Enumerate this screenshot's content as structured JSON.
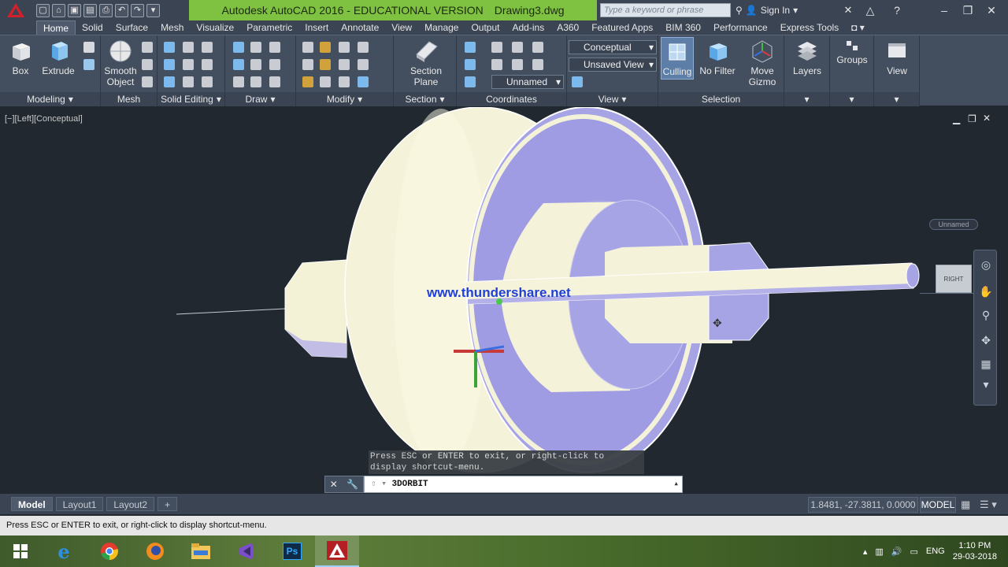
{
  "titlebar": {
    "title": "Autodesk AutoCAD 2016 - EDUCATIONAL VERSION",
    "filename": "Drawing3.dwg",
    "search_placeholder": "Type a keyword or phrase",
    "sign_in": "Sign In",
    "accent": "#7fc241"
  },
  "ribbon_tabs": [
    "Home",
    "Solid",
    "Surface",
    "Mesh",
    "Visualize",
    "Parametric",
    "Insert",
    "Annotate",
    "View",
    "Manage",
    "Output",
    "Add-ins",
    "A360",
    "Featured Apps",
    "BIM 360",
    "Performance",
    "Express Tools"
  ],
  "active_tab": "Home",
  "panels": {
    "modeling": {
      "title": "Modeling",
      "box": "Box",
      "extrude": "Extrude"
    },
    "mesh": {
      "title": "Mesh",
      "smooth_object_1": "Smooth",
      "smooth_object_2": "Object"
    },
    "solid_editing": {
      "title": "Solid Editing"
    },
    "draw": {
      "title": "Draw"
    },
    "modify": {
      "title": "Modify"
    },
    "section": {
      "title": "Section",
      "section_plane_1": "Section",
      "section_plane_2": "Plane"
    },
    "coordinates": {
      "title": "Coordinates",
      "ucs_name": "Unnamed"
    },
    "view": {
      "title": "View",
      "visual_style": "Conceptual",
      "saved_view": "Unsaved View"
    },
    "selection": {
      "title": "Selection",
      "culling": "Culling",
      "no_filter": "No Filter",
      "move_gizmo_1": "Move",
      "move_gizmo_2": "Gizmo"
    },
    "layers": {
      "label": "Layers"
    },
    "groups": {
      "label": "Groups"
    },
    "viewpanel": {
      "label": "View"
    }
  },
  "viewport": {
    "label": "[−][Left][Conceptual]",
    "watermark": "www.thundershare.net",
    "viewcube_face": "RIGHT",
    "wcs_label": "Unnamed",
    "tooltip": "Press ESC or ENTER to exit, or right-click to display shortcut-menu.",
    "command": "3DORBIT"
  },
  "layout_tabs": [
    "Model",
    "Layout1",
    "Layout2"
  ],
  "active_layout": "Model",
  "status": {
    "coordinates": "1.8481, -27.3811, 0.0000",
    "space": "MODEL",
    "prompt": "Press ESC or ENTER to exit, or right-click to display shortcut-menu."
  },
  "taskbar": {
    "apps": [
      "start-icon",
      "internet-explorer-icon",
      "chrome-icon",
      "firefox-icon",
      "file-explorer-icon",
      "visual-studio-icon",
      "photoshop-icon",
      "autocad-icon"
    ],
    "active_app": "autocad-icon",
    "language": "ENG",
    "time": "1:10 PM",
    "date": "29-03-2018"
  }
}
